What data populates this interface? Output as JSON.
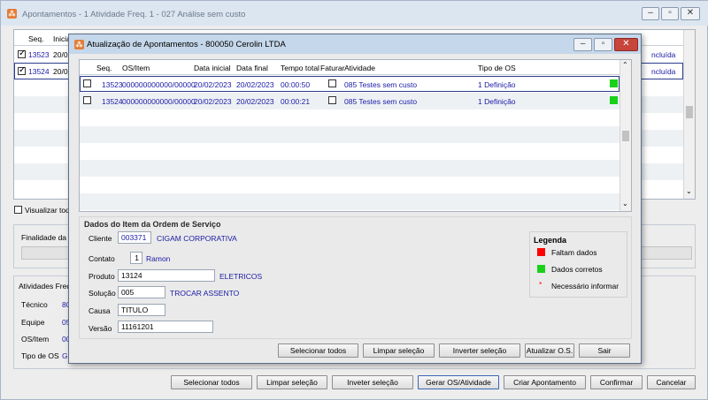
{
  "back_window": {
    "title": "Apontamentos - 1  Atividade Freq. 1 - 027  Análise sem custo",
    "grid": {
      "headers": [
        "Seq.",
        "Inicia"
      ],
      "rows": [
        {
          "seq": "13523",
          "start": "20/02",
          "status": "ncluída",
          "checked": true
        },
        {
          "seq": "13524",
          "start": "20/02",
          "status": "ncluída",
          "checked": true
        }
      ]
    },
    "visualizar_label": "Visualizar todo",
    "finalidade_label": "Finalidade da c",
    "atividades_label": "Atividades Freq",
    "fields": [
      {
        "label": "Técnico",
        "value": "80"
      },
      {
        "label": "Equipe",
        "value": "05"
      },
      {
        "label": "OS/Item",
        "value": "00"
      },
      {
        "label": "Tipo de OS",
        "value": "G"
      }
    ],
    "buttons": {
      "select_all": "Selecionar todos",
      "clear": "Limpar seleção",
      "invert": "Inveter seleção",
      "generate": "Gerar OS/Atividade",
      "create": "Criar Apontamento",
      "confirm": "Confirmar",
      "cancel": "Cancelar"
    }
  },
  "modal": {
    "title": "Atualização de Apontamentos  -  800050  Cerolin LTDA",
    "grid": {
      "headers": {
        "seq": "Seq.",
        "os_item": "OS/Item",
        "data_inicial": "Data inicial",
        "data_final": "Data final",
        "tempo_total": "Tempo total",
        "faturar": "Faturar",
        "atividade": "Atividade",
        "tipo_os": "Tipo de OS"
      },
      "rows": [
        {
          "seq": "13523",
          "os_item": "000000000000/00000",
          "data_inicial": "20/02/2023",
          "data_final": "20/02/2023",
          "tempo_total": "00:00:50",
          "atividade": "085  Testes sem custo",
          "tipo_os": "1  Definição",
          "color": "#19d119"
        },
        {
          "seq": "13524",
          "os_item": "000000000000/00000",
          "data_inicial": "20/02/2023",
          "data_final": "20/02/2023",
          "tempo_total": "00:00:21",
          "atividade": "085  Testes sem custo",
          "tipo_os": "1  Definição",
          "color": "#19d119"
        }
      ]
    },
    "dados": {
      "heading": "Dados do Item da Ordem de Serviço",
      "cliente_label": "Cliente",
      "cliente_code": "003371",
      "cliente_name": "CIGAM CORPORATIVA",
      "contato_label": "Contato",
      "contato_code": "1",
      "contato_name": "Ramon",
      "produto_label": "Produto",
      "produto_code": "13124",
      "produto_name": "ELETRICOS",
      "solucao_label": "Solução",
      "solucao_code": "005",
      "solucao_name": "TROCAR ASSENTO",
      "causa_label": "Causa",
      "causa_value": "TITULO",
      "versao_label": "Versão",
      "versao_value": "11161201"
    },
    "legenda": {
      "heading": "Legenda",
      "faltam": "Faltam dados",
      "faltam_color": "#ff0000",
      "corretos": "Dados corretos",
      "corretos_color": "#19d119",
      "necessario": "Necessário informar",
      "necessario_mark": "*"
    },
    "buttons": {
      "select_all": "Selecionar todos",
      "clear": "Limpar seleção",
      "invert": "Inverter seleção",
      "update": "Atualizar O.S.",
      "exit": "Sair"
    }
  }
}
